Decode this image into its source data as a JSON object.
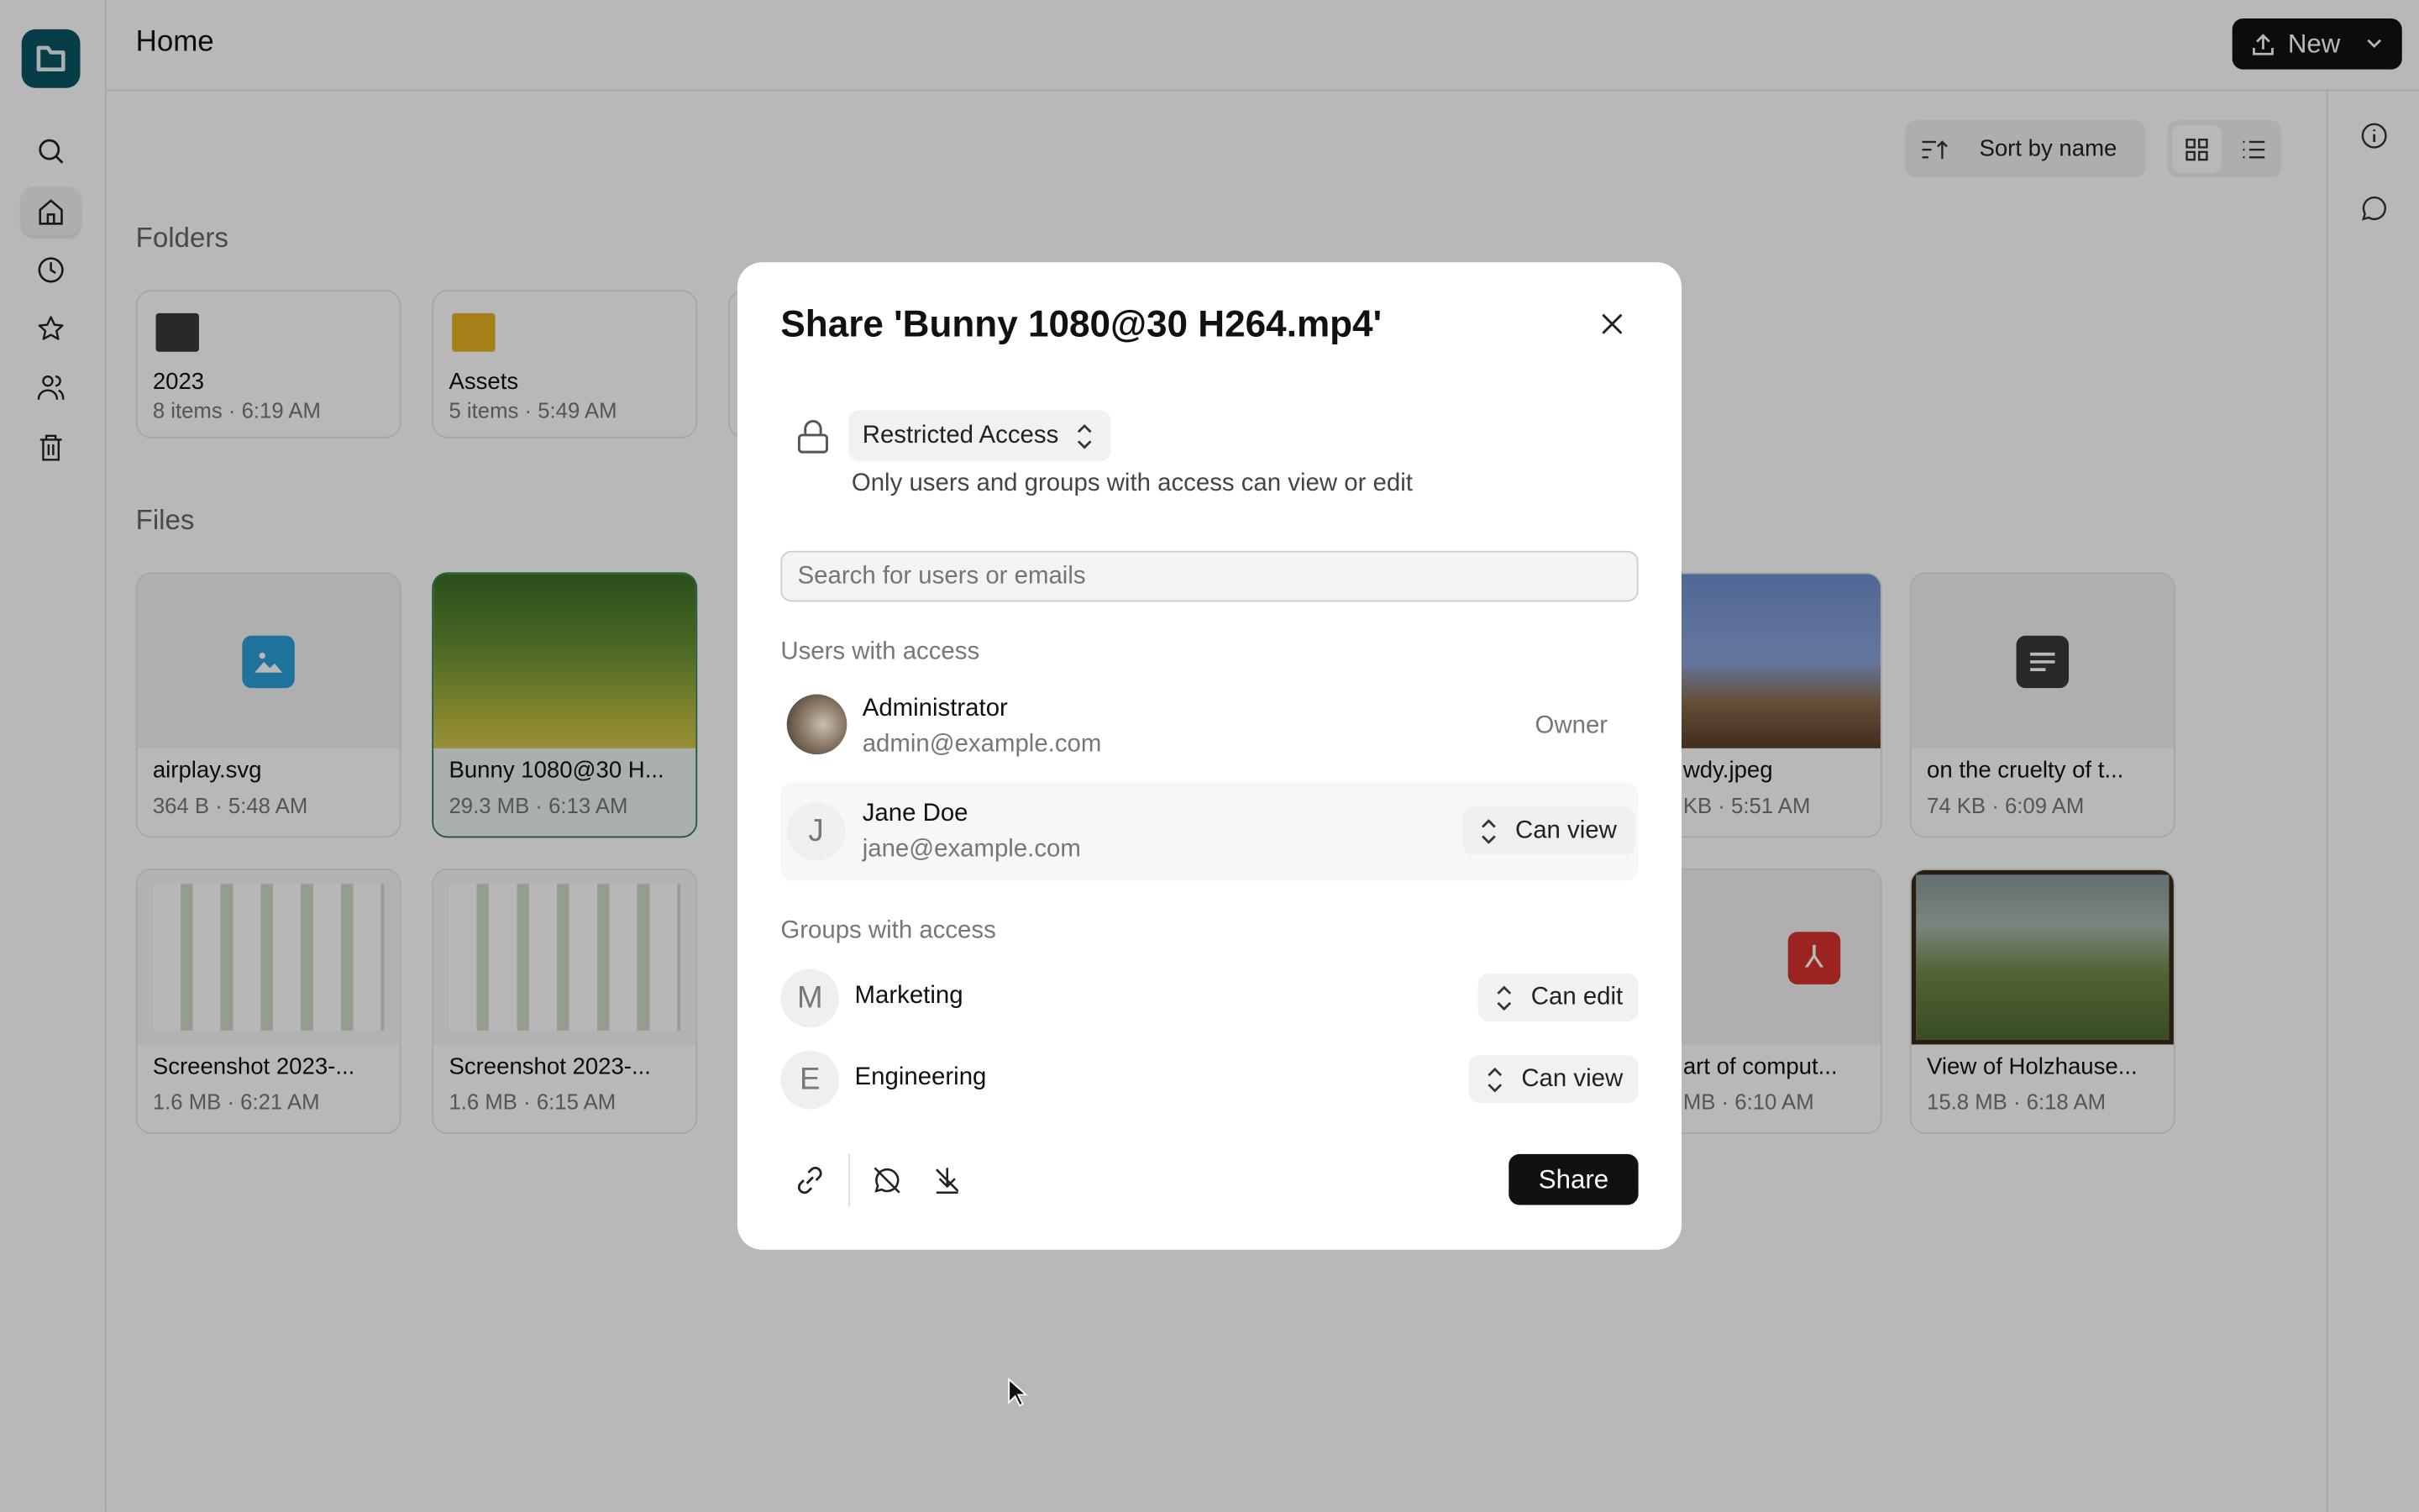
{
  "header": {
    "title": "Home",
    "new_label": "New"
  },
  "sidebar": {
    "items": [
      {
        "icon": "search-icon"
      },
      {
        "icon": "home-icon",
        "active": true
      },
      {
        "icon": "clock-icon"
      },
      {
        "icon": "star-icon"
      },
      {
        "icon": "users-icon"
      },
      {
        "icon": "trash-icon"
      }
    ]
  },
  "toolbar": {
    "sort_label": "Sort by name",
    "view": "grid"
  },
  "folders": {
    "heading": "Folders",
    "items": [
      {
        "name": "2023",
        "count": "8 items",
        "time": "6:19 AM",
        "color": "#3a3a3a"
      },
      {
        "name": "Assets",
        "count": "5 items",
        "time": "5:49 AM",
        "color": "#e6b222"
      }
    ]
  },
  "files": {
    "heading": "Files",
    "items": [
      {
        "name": "airplay.svg",
        "size": "364 B",
        "time": "5:48 AM"
      },
      {
        "name": "Bunny 1080@30 H...",
        "size": "29.3 MB",
        "time": "6:13 AM",
        "selected": true
      },
      {
        "name": "wdy.jpeg",
        "size": "KB",
        "time": "5:51 AM"
      },
      {
        "name": "on the cruelty of t...",
        "size": "74 KB",
        "time": "6:09 AM"
      },
      {
        "name": "Screenshot 2023-...",
        "size": "1.6 MB",
        "time": "6:21 AM"
      },
      {
        "name": "Screenshot 2023-...",
        "size": "1.6 MB",
        "time": "6:15 AM"
      },
      {
        "name": "art of comput...",
        "size": "MB",
        "time": "6:10 AM"
      },
      {
        "name": "View of Holzhause...",
        "size": "15.8 MB",
        "time": "6:18 AM"
      }
    ]
  },
  "dialog": {
    "title": "Share 'Bunny 1080@30 H264.mp4'",
    "access_mode": "Restricted Access",
    "access_description": "Only users and groups with access can view or edit",
    "search_placeholder": "Search for users or emails",
    "users_heading": "Users with access",
    "users": [
      {
        "name": "Administrator",
        "email": "admin@example.com",
        "role": "Owner"
      },
      {
        "initial": "J",
        "name": "Jane Doe",
        "email": "jane@example.com",
        "role": "Can view"
      }
    ],
    "groups_heading": "Groups with access",
    "groups": [
      {
        "initial": "M",
        "name": "Marketing",
        "role": "Can edit"
      },
      {
        "initial": "E",
        "name": "Engineering",
        "role": "Can view"
      }
    ],
    "share_label": "Share"
  },
  "colors": {
    "brand": "#0b5563",
    "selected_border": "#2e7d4f",
    "pdf": "#d7322f",
    "image_icon": "#2b9fd8"
  }
}
